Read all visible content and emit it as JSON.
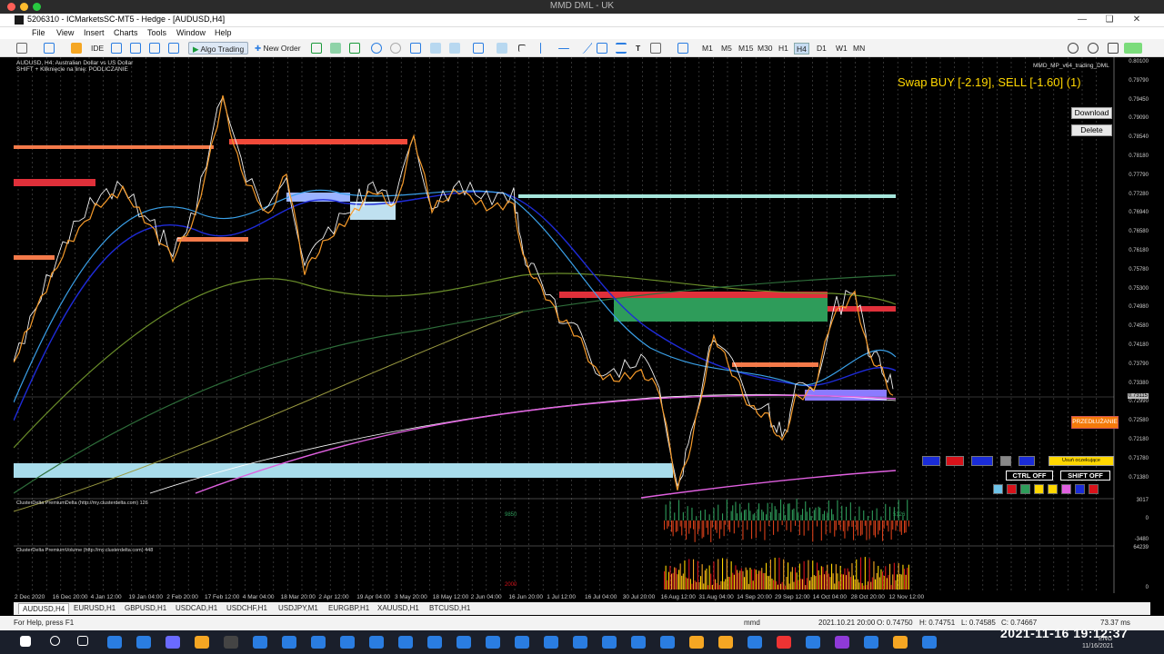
{
  "window": {
    "mac_title": "MMD DML - UK",
    "app_title": "5206310 - ICMarketsSC-MT5 - Hedge - [AUDUSD,H4]"
  },
  "menu": [
    "File",
    "View",
    "Insert",
    "Charts",
    "Tools",
    "Window",
    "Help"
  ],
  "toolbar": {
    "ide_label": "IDE",
    "algo_label": "Algo Trading",
    "order_label": "New Order",
    "timeframes": [
      "M1",
      "M5",
      "M15",
      "M30",
      "H1",
      "H4",
      "D1",
      "W1",
      "MN"
    ],
    "active_timeframe": "H4"
  },
  "chart": {
    "symbol_desc": "AUDUSD, H4:  Australian Dollar vs US Dollar",
    "shift_hint": "SHIFT + Kliknięcie na linię: PODLICZANIE",
    "indicator_name": "MMD_MP_v64_trading_DML",
    "swap_text": "Swap BUY [-2.19],  SELL [-1.60]   (1)",
    "download_label": "Download",
    "delete_label": "Delete",
    "przedluzanie_label": "PRZEDŁUŻANIE",
    "usun_label": "Usuń oczekujące",
    "ctrl_label": "CTRL OFF",
    "shift_label": "SHIFT OFF",
    "delta_label": "ClusterDelta PremiumDelta (http://my.clusterdelta.com) 126",
    "volume_label": "ClusterDelta PremiumVolume (http://my.clusterdelta.com) 448",
    "delta_scale": [
      "3017",
      "0",
      "-3480"
    ],
    "volume_scale": [
      "64239",
      "0"
    ],
    "delta_small_left": "9850",
    "delta_small_right": "5126",
    "volume_small": "2000",
    "prices": [
      "0.80100",
      "0.79790",
      "0.79450",
      "0.79090",
      "0.78540",
      "0.78180",
      "0.77790",
      "0.77280",
      "0.76940",
      "0.76580",
      "0.76180",
      "0.75780",
      "0.75300",
      "0.74980",
      "0.74580",
      "0.74180",
      "0.73790",
      "0.73380",
      "0.72990",
      "0.72580",
      "0.72180",
      "0.71780",
      "0.71380"
    ],
    "current_price": "0.73115",
    "dates": [
      "2 Dec 2020",
      "16 Dec 20:00",
      "4 Jan 12:00",
      "19 Jan 04:00",
      "2 Feb 20:00",
      "17 Feb 12:00",
      "4 Mar 04:00",
      "18 Mar 20:00",
      "2 Apr 12:00",
      "19 Apr 04:00",
      "3 May 20:00",
      "18 May 12:00",
      "2 Jun 04:00",
      "16 Jun 20:00",
      "1 Jul 12:00",
      "16 Jul 04:00",
      "30 Jul 20:00",
      "16 Aug 12:00",
      "31 Aug 04:00",
      "14 Sep 20:00",
      "29 Sep 12:00",
      "14 Oct 04:00",
      "28 Oct 20:00",
      "12 Nov 12:00"
    ]
  },
  "symbol_tabs": [
    "AUDUSD,H4",
    "EURUSD,H1",
    "GBPUSD,H1",
    "USDCAD,H1",
    "USDCHF,H1",
    "USDJPY,M1",
    "EURGBP,H1",
    "XAUUSD,H1",
    "BTCUSD,H1"
  ],
  "status": {
    "help": "For Help, press F1",
    "profile": "mmd",
    "time": "2021.10.21 20:00",
    "open": "O: 0.74750",
    "high": "H: 0.74751",
    "low": "L: 0.74585",
    "close": "C: 0.74667",
    "traffic": "73.37 ms"
  },
  "taskbar": {
    "clock": "2021-11-16  19:12:37",
    "date": "11/16/2021",
    "lang": "ENG"
  },
  "colors": {
    "gold": "#ffd700",
    "resistance": "#e8463a",
    "support": "#2e9c5a",
    "zone_blue": "#9bb3ff",
    "magenta": "#e060e0"
  }
}
